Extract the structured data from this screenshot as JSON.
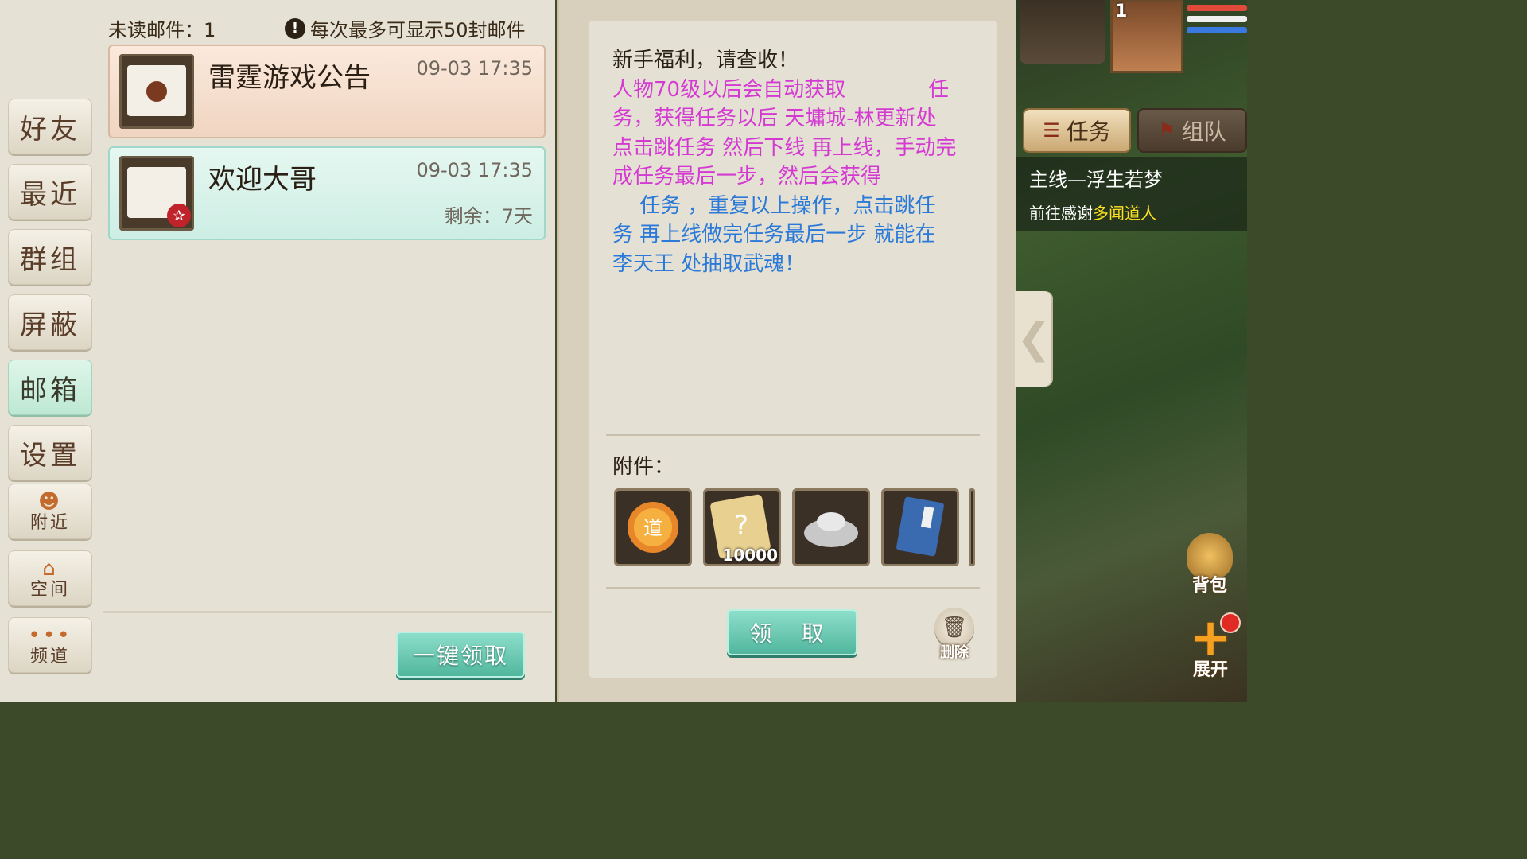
{
  "header": {
    "unread_label": "未读邮件：1",
    "limit_note": "每次最多可显示50封邮件"
  },
  "side_nav": {
    "items": [
      {
        "label": "好友"
      },
      {
        "label": "最近"
      },
      {
        "label": "群组"
      },
      {
        "label": "屏蔽"
      },
      {
        "label": "邮箱",
        "active": true
      },
      {
        "label": "设置"
      },
      {
        "label": "附近",
        "icon": "add-person-icon"
      },
      {
        "label": "空间",
        "icon": "home-icon"
      },
      {
        "label": "频道",
        "icon": "chat-bubble-icon"
      }
    ]
  },
  "mail_list": {
    "items": [
      {
        "title": "雷霆游戏公告",
        "time": "09-03 17:35",
        "remaining": "",
        "icon": "sealed-envelope-icon"
      },
      {
        "title": "欢迎大哥",
        "time": "09-03 17:35",
        "remaining": "剩余：7天",
        "icon": "letter-attachment-icon"
      }
    ],
    "claim_all_label": "一键领取"
  },
  "mail_detail": {
    "greeting": "新手福利，请查收！",
    "lines_pink": [
      "人物70级以后会自动获取　　　　任",
      "务，获得任务以后 天墉城-林更新处",
      "点击跳任务 然后下线 再上线，手动完",
      "成任务最后一步，然后会获得"
    ],
    "lines_blue": [
      "　 任务 ，重复以上操作，点击跳任",
      "务 再上线做完任务最后一步 就能在",
      "李天王 处抽取武魂！"
    ],
    "attachments_label": "附件：",
    "attachments": [
      {
        "icon": "dao-coin-icon",
        "count": ""
      },
      {
        "icon": "mystery-card-icon",
        "count": "10000"
      },
      {
        "icon": "silver-ingot-icon",
        "count": ""
      },
      {
        "icon": "skill-book-icon",
        "count": ""
      }
    ],
    "claim_label": "领 取",
    "delete_label": "删除"
  },
  "hud": {
    "player_level": "1",
    "tabs": {
      "task": "任务",
      "team": "组队"
    },
    "quest": {
      "title": "主线—浮生若梦",
      "desc_prefix": "前往感谢",
      "npc": "多闻道人"
    },
    "bag_label": "背包",
    "expand_label": "展开"
  },
  "colors": {
    "pink_text": "#d43ad2",
    "blue_text": "#2b7ad8",
    "button_green": "#4fb59c",
    "npc_yellow": "#ffe020"
  }
}
